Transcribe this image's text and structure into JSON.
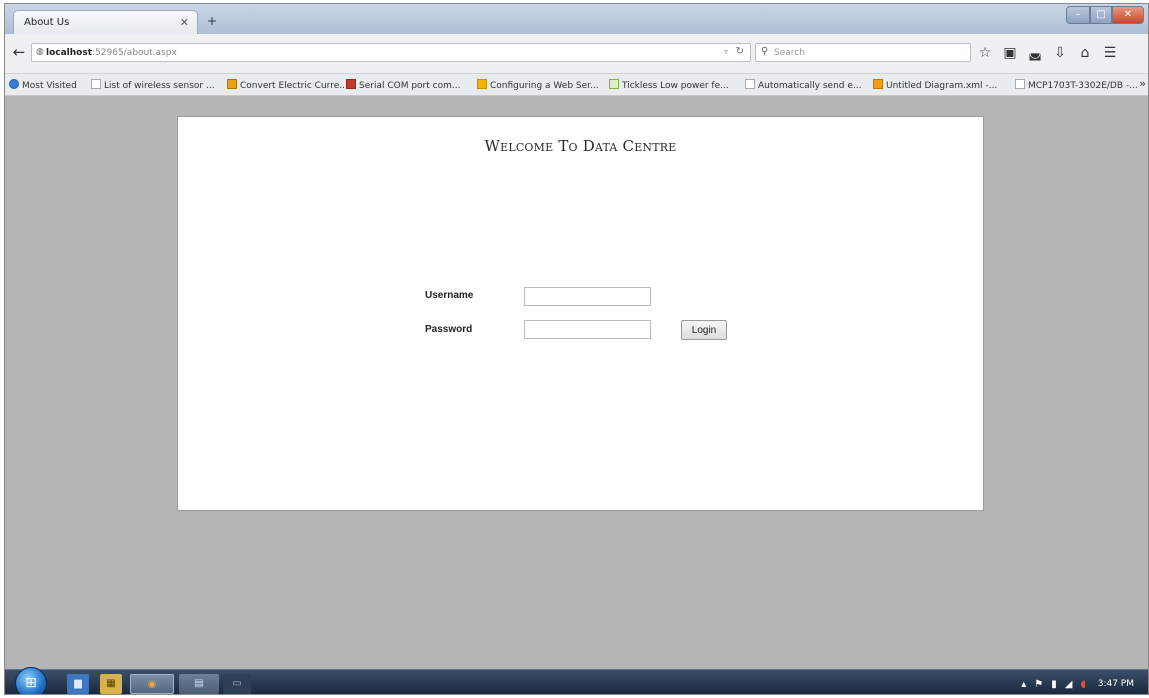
{
  "window": {
    "tab_title": "About Us",
    "tab_close": "✕",
    "new_tab": "+",
    "controls": {
      "minimize": "–",
      "maximize": "□",
      "close": "✕"
    }
  },
  "navbar": {
    "back": "←",
    "url_host": "localhost",
    "url_path": ":52965/about.aspx",
    "search_placeholder": "Search",
    "icons": [
      "bookmark-star-icon",
      "reading-list-icon",
      "pocket-icon",
      "download-icon",
      "home-icon",
      "menu-icon"
    ]
  },
  "bookmarks": [
    {
      "label": "Most Visited",
      "color": "#3a7bd5"
    },
    {
      "label": "List of wireless sensor ...",
      "color": "#ffffff"
    },
    {
      "label": "Convert Electric Curre...",
      "color": "#e8a317"
    },
    {
      "label": "Serial COM port com...",
      "color": "#c0392b"
    },
    {
      "label": "Configuring a Web Ser...",
      "color": "#f4b400"
    },
    {
      "label": "Tickless Low power fe...",
      "color": "#7cb342"
    },
    {
      "label": "Automatically send e...",
      "color": "#ffffff"
    },
    {
      "label": "Untitled Diagram.xml -...",
      "color": "#f39c12"
    },
    {
      "label": "MCP1703T-3302E/DB -...",
      "color": "#ffffff"
    }
  ],
  "page": {
    "title": "Welcome To Data Centre",
    "username_label": "Username",
    "password_label": "Password",
    "username_value": "",
    "password_value": "",
    "login_label": "Login"
  },
  "taskbar": {
    "clock": "3:47 PM"
  },
  "colors": {
    "page_background": "#b5b5b5",
    "panel_background": "#ffffff",
    "taskbar": "#17263a"
  }
}
